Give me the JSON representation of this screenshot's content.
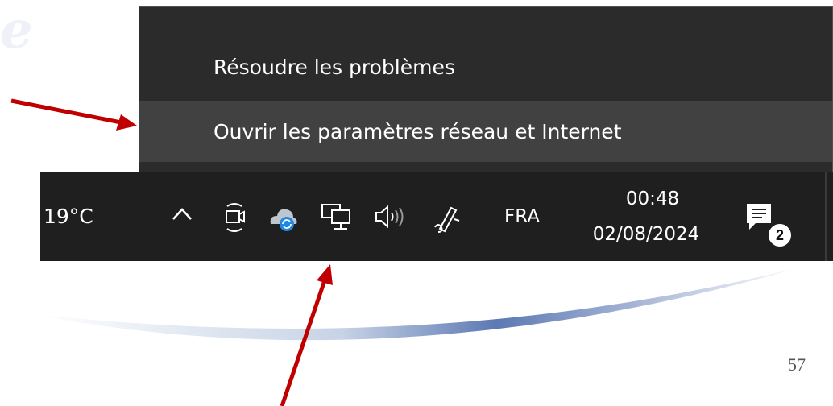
{
  "menu": {
    "items": [
      {
        "label": "Résoudre les problèmes"
      },
      {
        "label": "Ouvrir les paramètres réseau et Internet"
      }
    ]
  },
  "taskbar": {
    "temperature": "19°C",
    "language": "FRA",
    "time": "00:48",
    "date": "02/08/2024",
    "notification_count": "2",
    "icons": [
      "chevron-up-icon",
      "meet-now-icon",
      "onedrive-sync-icon",
      "network-icon",
      "volume-icon",
      "pen-icon",
      "notification-center-icon"
    ]
  },
  "slide": {
    "page_number": "57"
  },
  "colors": {
    "menu_bg": "#2b2b2b",
    "menu_hover": "#414141",
    "taskbar_bg": "#1f1f1f",
    "arrow": "#c00000"
  }
}
